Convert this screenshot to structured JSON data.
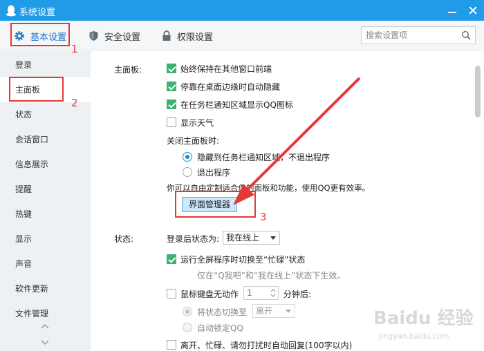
{
  "window": {
    "title": "系统设置"
  },
  "tabs": [
    {
      "label": "基本设置"
    },
    {
      "label": "安全设置"
    },
    {
      "label": "权限设置"
    }
  ],
  "search": {
    "placeholder": "搜索设置项"
  },
  "sidebar": {
    "items": [
      {
        "label": "登录"
      },
      {
        "label": "主面板"
      },
      {
        "label": "状态"
      },
      {
        "label": "会话窗口"
      },
      {
        "label": "信息展示"
      },
      {
        "label": "提醒"
      },
      {
        "label": "热键"
      },
      {
        "label": "显示"
      },
      {
        "label": "声音"
      },
      {
        "label": "软件更新"
      },
      {
        "label": "文件管理"
      }
    ]
  },
  "panel": {
    "label": "主面板:",
    "options": [
      {
        "label": "始终保持在其他窗口前端",
        "checked": true
      },
      {
        "label": "停靠在桌面边缘时自动隐藏",
        "checked": true
      },
      {
        "label": "在任务栏通知区域显示QQ图标",
        "checked": true
      },
      {
        "label": "显示天气",
        "checked": false
      }
    ],
    "close_label": "关闭主面板时:",
    "close_options": [
      {
        "label": "隐藏到任务栏通知区域，不退出程序",
        "checked": true
      },
      {
        "label": "退出程序",
        "checked": false
      }
    ],
    "custom_text": "你可以自由定制适合你的面板和功能，使用QQ更有效率。",
    "manager_button": "界面管理器"
  },
  "status": {
    "label": "状态:",
    "after_login_label": "登录后状态为:",
    "after_login_value": "我在线上",
    "fullscreen_label": "运行全屏程序时切换至“忙碌”状态",
    "fullscreen_note": "仅在“Q我吧”和“我在线上”状态下生效。",
    "idle_label": "鼠标键盘无动作",
    "idle_value": "1",
    "idle_unit": "分钟后:",
    "switch_label": "将状态切换至",
    "switch_value": "离开",
    "autolock_label": "自动锁定QQ",
    "auto_reply_label": "离开、忙碌、请勿打扰时自动回复(100字以内)"
  },
  "annotations": [
    "1",
    "2",
    "3"
  ],
  "watermark": {
    "main": "Baidu 经验",
    "sub": "jingyan.baidu.com"
  },
  "colors": {
    "titlebar": "#1f9be8",
    "accent": "#1a73c6",
    "check": "#3cb371",
    "annotation": "#e53935"
  }
}
